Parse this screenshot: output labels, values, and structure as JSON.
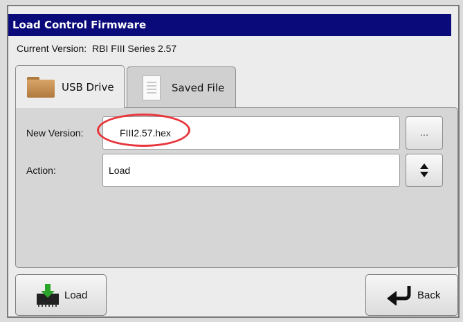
{
  "dialog": {
    "title": "Load Control Firmware"
  },
  "current_version": {
    "label": "Current Version:",
    "value": "RBI FIII Series 2.57"
  },
  "tabs": [
    {
      "label": "USB Drive",
      "icon": "folder-icon",
      "active": true
    },
    {
      "label": "Saved File",
      "icon": "document-icon",
      "active": false
    }
  ],
  "fields": {
    "new_version": {
      "label": "New Version:",
      "value": "FIII2.57.hex",
      "browse_label": "..."
    },
    "action": {
      "label": "Action:",
      "value": "Load"
    }
  },
  "buttons": {
    "load": "Load",
    "back": "Back"
  },
  "colors": {
    "title_bar": "#0a0a7a",
    "highlight": "#e8343a",
    "load_icon": "#2aa52a"
  }
}
